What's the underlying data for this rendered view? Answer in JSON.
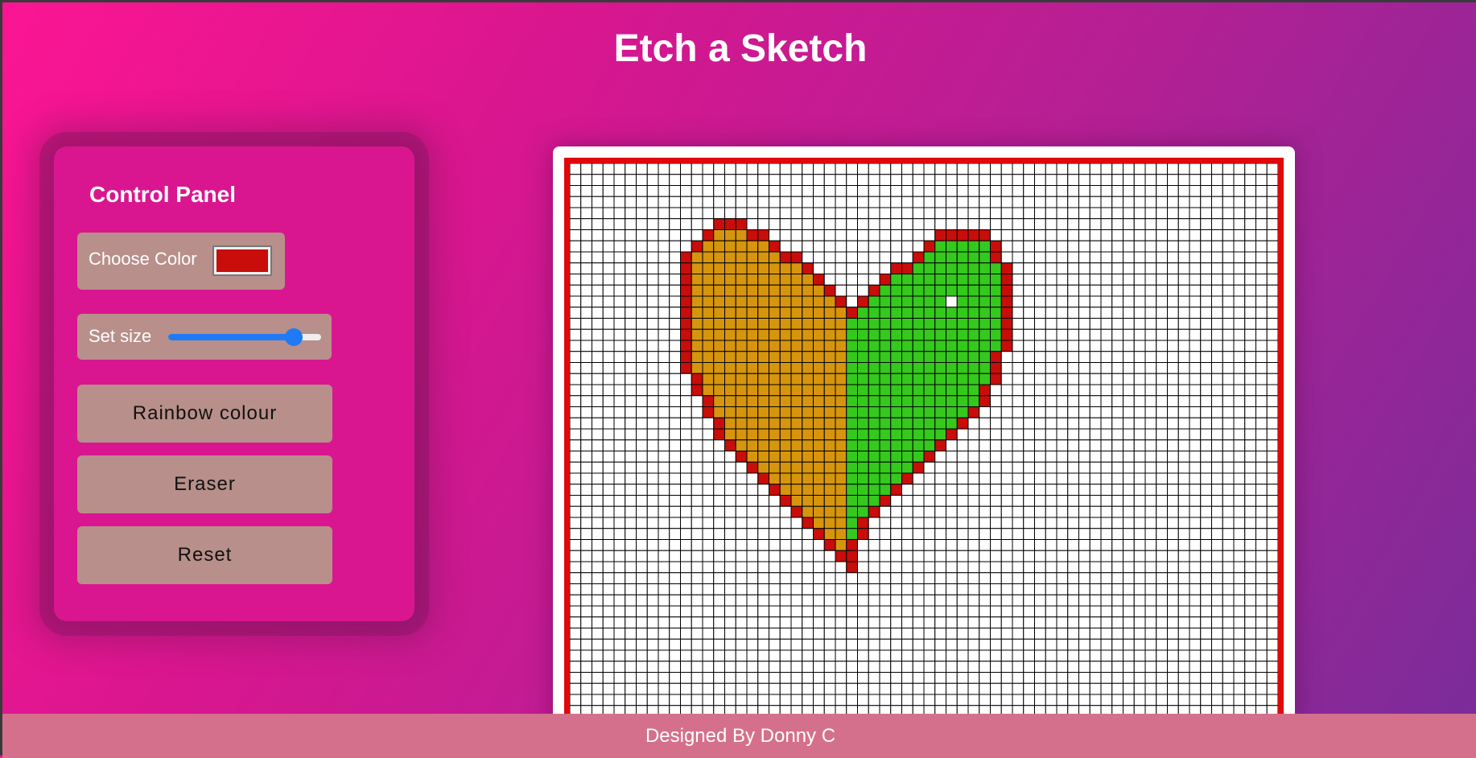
{
  "header": {
    "title": "Etch a Sketch"
  },
  "control_panel": {
    "title": "Control Panel",
    "color_label": "Choose Color",
    "color_value": "#c80d0a",
    "size_label": "Set size",
    "size_slider_fraction": 0.82,
    "rainbow_label": "Rainbow colour",
    "eraser_label": "Eraser",
    "reset_label": "Reset"
  },
  "canvas": {
    "grid_columns": 64,
    "colors": {
      "outline": "#c80d0a",
      "left_fill": "#d6950d",
      "right_fill": "#35c81d",
      "empty": "#ffffff",
      "gridline": "#000000"
    }
  },
  "footer": {
    "credit": "Designed By Donny C"
  }
}
